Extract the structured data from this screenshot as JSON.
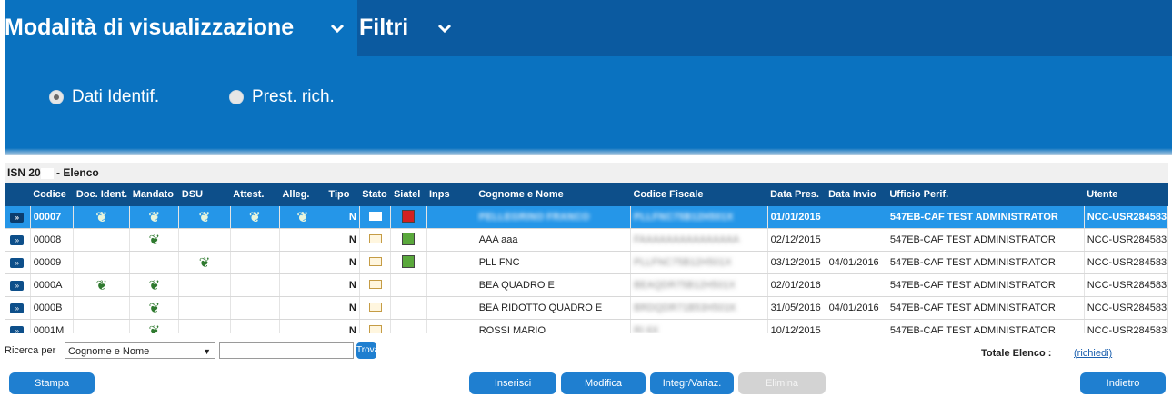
{
  "header": {
    "mode_title": "Modalità di visualizzazione",
    "filter_title": "Filtri",
    "radios": [
      {
        "label": "Dati Identif.",
        "checked": true
      },
      {
        "label": "Prest. rich.",
        "checked": false
      }
    ]
  },
  "list": {
    "caption_left": "ISN 20",
    "caption_right": " - Elenco",
    "columns": [
      "",
      "Codice",
      "Doc. Ident.",
      "Mandato",
      "DSU",
      "Attest.",
      "Alleg.",
      "Tipo",
      "Stato",
      "Siatel",
      "Inps",
      "Cognome e Nome",
      "Codice Fiscale",
      "Data Pres.",
      "Data Invio",
      "Ufficio Perif.",
      "Utente"
    ],
    "row_button_label": "»",
    "rows": [
      {
        "codice": "00007",
        "doc": true,
        "mandato": true,
        "dsu": true,
        "attest": true,
        "alleg": true,
        "tipo": "N",
        "stato": "envelope",
        "siatel": "red-flag",
        "nome": "PELLEGRINO FRANCO",
        "cf": "PLLFNC75B12H501X",
        "data_pres": "01/01/2016",
        "data_invio": "",
        "ufficio": "547EB-CAF TEST ADMINISTRATOR",
        "utente": "NCC-USR284583",
        "selected": true
      },
      {
        "codice": "00008",
        "doc": false,
        "mandato": true,
        "dsu": false,
        "attest": false,
        "alleg": false,
        "tipo": "N",
        "stato": "envelope",
        "siatel": "green-flag",
        "nome": "AAA aaa",
        "cf": "FAAAAAAAAAAAAAAA",
        "data_pres": "02/12/2015",
        "data_invio": "",
        "ufficio": "547EB-CAF TEST ADMINISTRATOR",
        "utente": "NCC-USR284583",
        "selected": false
      },
      {
        "codice": "00009",
        "doc": false,
        "mandato": false,
        "dsu": true,
        "attest": false,
        "alleg": false,
        "tipo": "N",
        "stato": "envelope",
        "siatel": "green-flag",
        "nome": "PLL FNC",
        "cf": "PLLFNC75B12H501X",
        "data_pres": "03/12/2015",
        "data_invio": "04/01/2016",
        "ufficio": "547EB-CAF TEST ADMINISTRATOR",
        "utente": "NCC-USR284583",
        "selected": false
      },
      {
        "codice": "0000A",
        "doc": true,
        "mandato": true,
        "dsu": false,
        "attest": false,
        "alleg": false,
        "tipo": "N",
        "stato": "envelope",
        "siatel": "",
        "nome": "BEA QUADRO E",
        "cf": "BEAQDR75B12H501X",
        "data_pres": "02/01/2016",
        "data_invio": "",
        "ufficio": "547EB-CAF TEST ADMINISTRATOR",
        "utente": "NCC-USR284583",
        "selected": false
      },
      {
        "codice": "0000B",
        "doc": false,
        "mandato": true,
        "dsu": false,
        "attest": false,
        "alleg": false,
        "tipo": "N",
        "stato": "envelope",
        "siatel": "",
        "nome": "BEA RIDOTTO QUADRO E",
        "cf": "BRDQDR71B53H501K",
        "data_pres": "31/05/2016",
        "data_invio": "04/01/2016",
        "ufficio": "547EB-CAF TEST ADMINISTRATOR",
        "utente": "NCC-USR284583",
        "selected": false
      },
      {
        "codice": "0001M",
        "doc": false,
        "mandato": true,
        "dsu": false,
        "attest": false,
        "alleg": false,
        "tipo": "N",
        "stato": "envelope",
        "siatel": "",
        "nome": "ROSSI MARIO",
        "cf": "RI                    6X",
        "data_pres": "10/12/2015",
        "data_invio": "",
        "ufficio": "547EB-CAF TEST ADMINISTRATOR",
        "utente": "NCC-USR284583",
        "selected": false
      }
    ]
  },
  "search": {
    "label": "Ricerca per",
    "field_value": "Cognome e Nome",
    "input_value": "",
    "trova_label": "Trova",
    "totale_label": "Totale Elenco :",
    "richiedi_label": "(richiedi)"
  },
  "actions": {
    "stampa": "Stampa",
    "inserisci": "Inserisci",
    "modifica": "Modifica",
    "integr": "Integr/Variaz.",
    "elimina": "Elimina",
    "indietro": "Indietro"
  },
  "colors": {
    "panel_blue": "#0a72c0",
    "header_dark": "#0d4f8a",
    "selected_row": "#2596e8",
    "button_blue": "#1f7fd0"
  }
}
